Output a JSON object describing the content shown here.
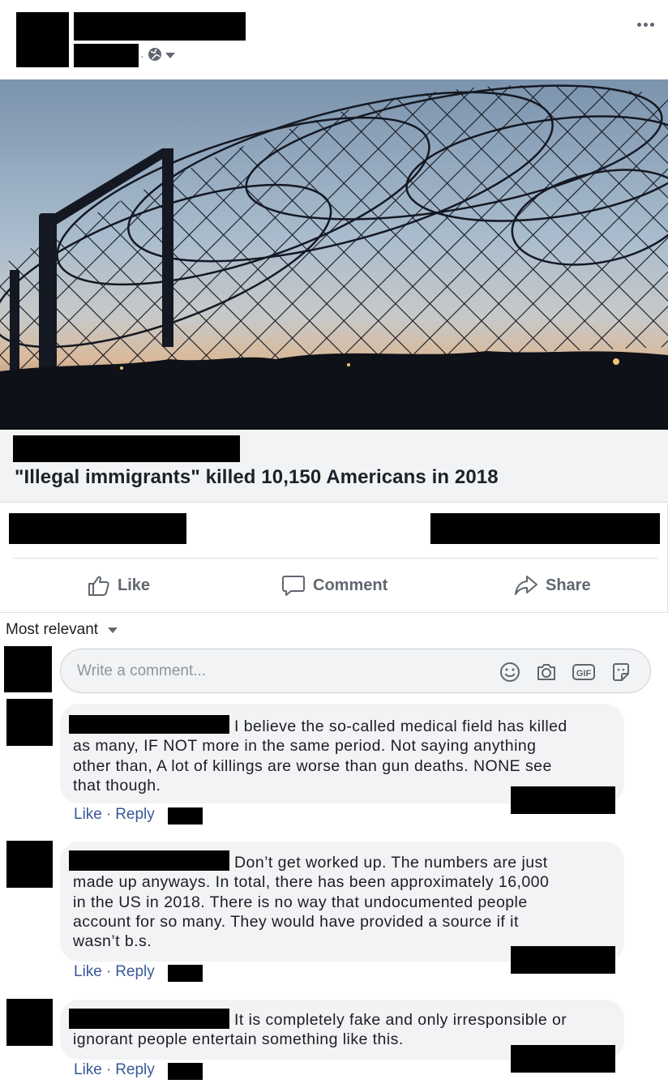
{
  "post": {
    "privacy_icon": "globe-icon",
    "more_icon": "more-dots-icon"
  },
  "link_preview": {
    "title": "\"Illegal immigrants\" killed 10,150 Americans in 2018"
  },
  "actions": {
    "like_label": "Like",
    "comment_label": "Comment",
    "share_label": "Share"
  },
  "comments_section": {
    "sort_label": "Most relevant",
    "composer_placeholder": "Write a comment...",
    "composer_icons": [
      "emoji-icon",
      "camera-icon",
      "gif-icon",
      "sticker-icon"
    ],
    "gif_text": "GIF"
  },
  "comments": [
    {
      "lines": [
        "I believe the so-called medical field has killed",
        "as many, IF NOT more in the same period. Not saying anything",
        "other than, A lot of killings are worse than gun deaths. NONE see",
        "that though."
      ],
      "like": "Like",
      "reply": "Reply"
    },
    {
      "lines": [
        "Don’t get worked up. The numbers are just",
        "made up anyways. In total, there has been approximately 16,000",
        "in the US in 2018. There is no way that undocumented people",
        "account for so many. They would have provided a source if it",
        "wasn’t b.s."
      ],
      "like": "Like",
      "reply": "Reply"
    },
    {
      "lines": [
        "It is completely fake and only irresponsible or",
        "ignorant people entertain something like this."
      ],
      "like": "Like",
      "reply": "Reply"
    }
  ]
}
